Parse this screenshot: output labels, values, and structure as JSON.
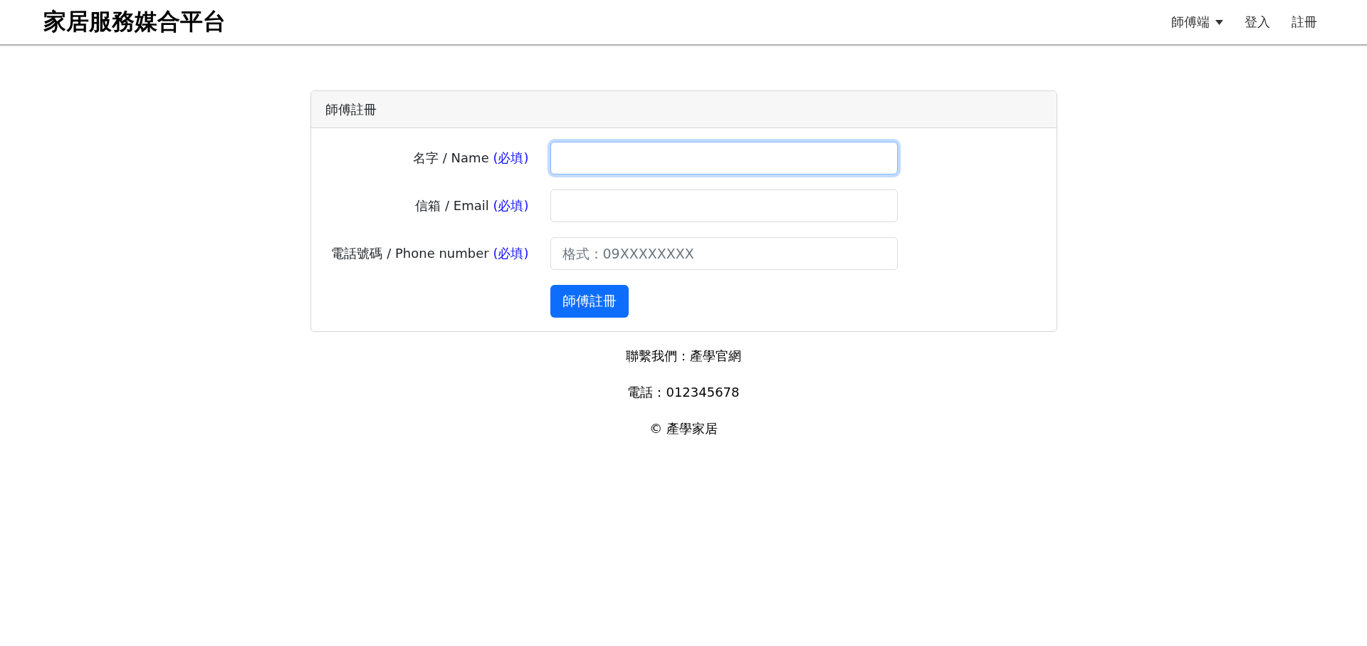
{
  "navbar": {
    "brand": "家居服務媒合平台",
    "items": [
      {
        "label": "師傅端",
        "kind": "dropdown"
      },
      {
        "label": "登入",
        "kind": "link"
      },
      {
        "label": "註冊",
        "kind": "link"
      }
    ]
  },
  "card": {
    "title": "師傅註冊",
    "fields": [
      {
        "label": "名字 / Name",
        "required_note": "(必填)",
        "focused": true
      },
      {
        "label": "信箱 / Email",
        "required_note": "(必填)",
        "focused": false
      },
      {
        "label": "電話號碼 / Phone number",
        "required_note": "(必填)",
        "placeholder": "格式：09XXXXXXXX",
        "focused": false
      }
    ],
    "submit": "師傅註冊"
  },
  "footer": [
    "聯繫我們：產學官網",
    "電話：012345678",
    "© 產學家居"
  ]
}
